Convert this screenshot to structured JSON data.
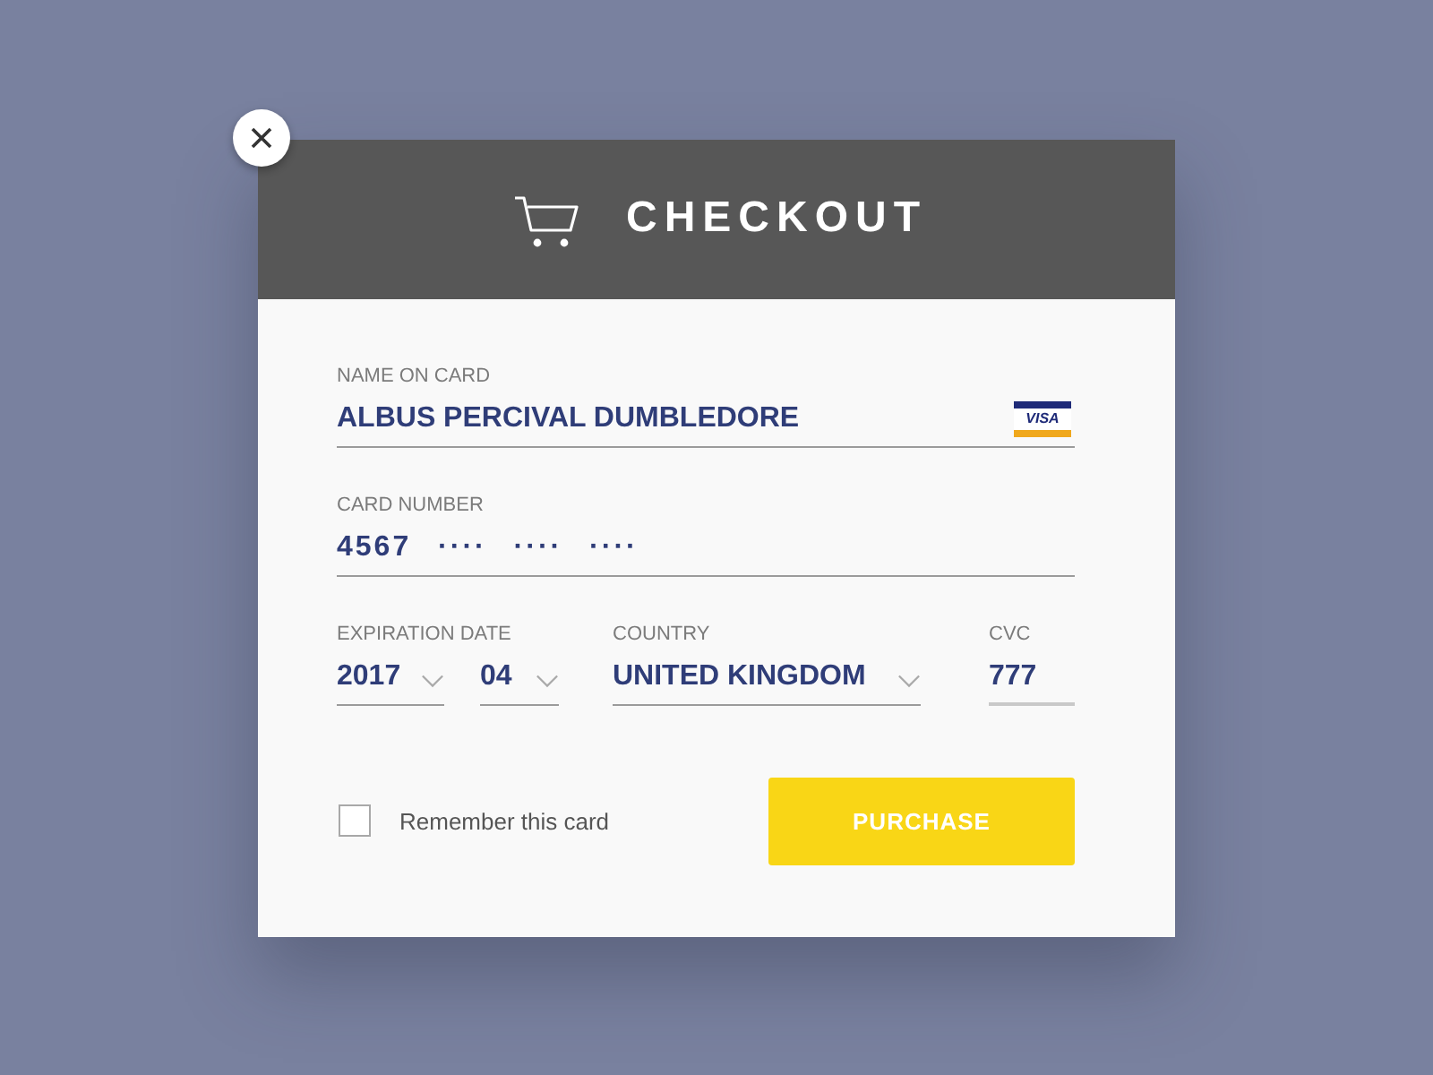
{
  "dialog": {
    "title": "CHECKOUT"
  },
  "form": {
    "name_on_card": {
      "label": "NAME ON CARD",
      "value": "ALBUS PERCIVAL DUMBLEDORE",
      "card_brand": "VISA"
    },
    "card_number": {
      "label": "CARD NUMBER",
      "value": "4567 ···· ···· ····"
    },
    "expiration_date": {
      "label": "EXPIRATION DATE",
      "year": "2017",
      "month": "04"
    },
    "country": {
      "label": "COUNTRY",
      "value": "UNITED KINGDOM"
    },
    "cvc": {
      "label": "CVC",
      "value": "777"
    },
    "remember_card": {
      "label": "Remember this card",
      "checked": false
    },
    "purchase_button": {
      "label": "PURCHASE"
    }
  }
}
